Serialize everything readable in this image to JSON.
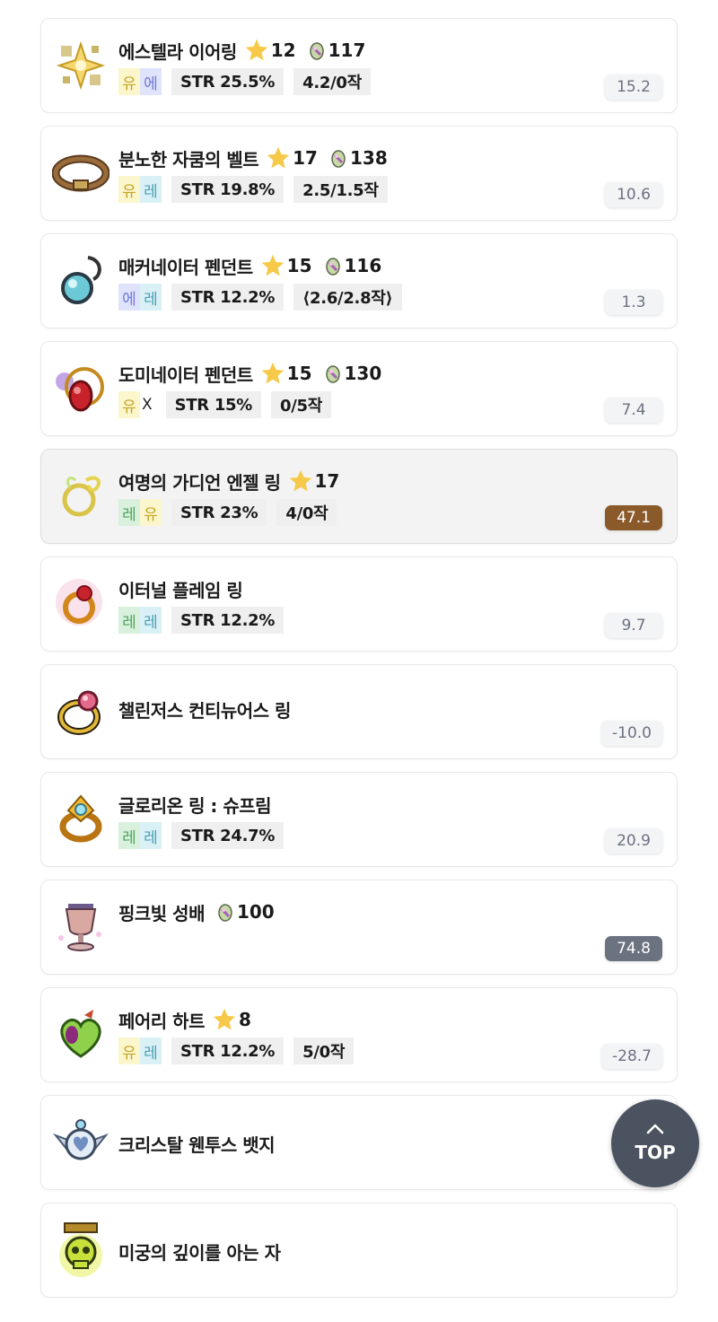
{
  "colors": {
    "score_default_bg": "#f3f4f6",
    "score_highlight_bg": "#8b5a2b",
    "score_dark_bg": "#6b7280",
    "top_button_bg": "#4b5360",
    "potential_unique": "#fbf6cc",
    "potential_epic": "#dfe3fb",
    "potential_legendary": "#d9f1dc"
  },
  "items": [
    {
      "name": "에스텔라 이어링",
      "stars": "12",
      "scroll": "117",
      "potential": [
        "유",
        "에"
      ],
      "stat": "STR 25.5%",
      "upgrade": "4.2/0작",
      "score": "15.2",
      "icon": "earring-icon"
    },
    {
      "name": "분노한 자쿰의 벨트",
      "stars": "17",
      "scroll": "138",
      "potential": [
        "유",
        "레"
      ],
      "stat": "STR 19.8%",
      "upgrade": "2.5/1.5작",
      "score": "10.6",
      "icon": "belt-icon"
    },
    {
      "name": "매커네이터 펜던트",
      "stars": "15",
      "scroll": "116",
      "potential": [
        "에",
        "레"
      ],
      "stat": "STR 12.2%",
      "upgrade": "⟨2.6/2.8작⟩",
      "score": "1.3",
      "icon": "pendant-blue-icon"
    },
    {
      "name": "도미네이터 펜던트",
      "stars": "15",
      "scroll": "130",
      "potential": [
        "유",
        "X"
      ],
      "stat": "STR 15%",
      "upgrade": "0/5작",
      "score": "7.4",
      "icon": "pendant-red-icon"
    },
    {
      "name": "여명의 가디언 엔젤 링",
      "stars": "17",
      "potential": [
        "레",
        "유"
      ],
      "stat": "STR 23%",
      "upgrade": "4/0작",
      "score": "47.1",
      "icon": "ring-angel-icon"
    },
    {
      "name": "이터널 플레임 링",
      "potential": [
        "레",
        "레"
      ],
      "stat": "STR 12.2%",
      "score": "9.7",
      "icon": "ring-flame-icon"
    },
    {
      "name": "챌린저스 컨티뉴어스 링",
      "score": "-10.0",
      "icon": "ring-gold-icon"
    },
    {
      "name": "글로리온 링 : 슈프림",
      "potential": [
        "레",
        "레"
      ],
      "stat": "STR 24.7%",
      "score": "20.9",
      "icon": "ring-glorion-icon"
    },
    {
      "name": "핑크빛 성배",
      "scroll": "100",
      "score": "74.8",
      "icon": "chalice-icon"
    },
    {
      "name": "페어리 하트",
      "stars": "8",
      "potential": [
        "유",
        "레"
      ],
      "stat": "STR 12.2%",
      "upgrade": "5/0작",
      "score": "-28.7",
      "icon": "heart-icon"
    },
    {
      "name": "크리스탈 웬투스 뱃지",
      "icon": "badge-icon"
    },
    {
      "name": "미궁의 깊이를 아는 자",
      "icon": "skull-medal-icon"
    }
  ],
  "top_button": {
    "label": "TOP",
    "icon": "chevron-up-icon"
  }
}
